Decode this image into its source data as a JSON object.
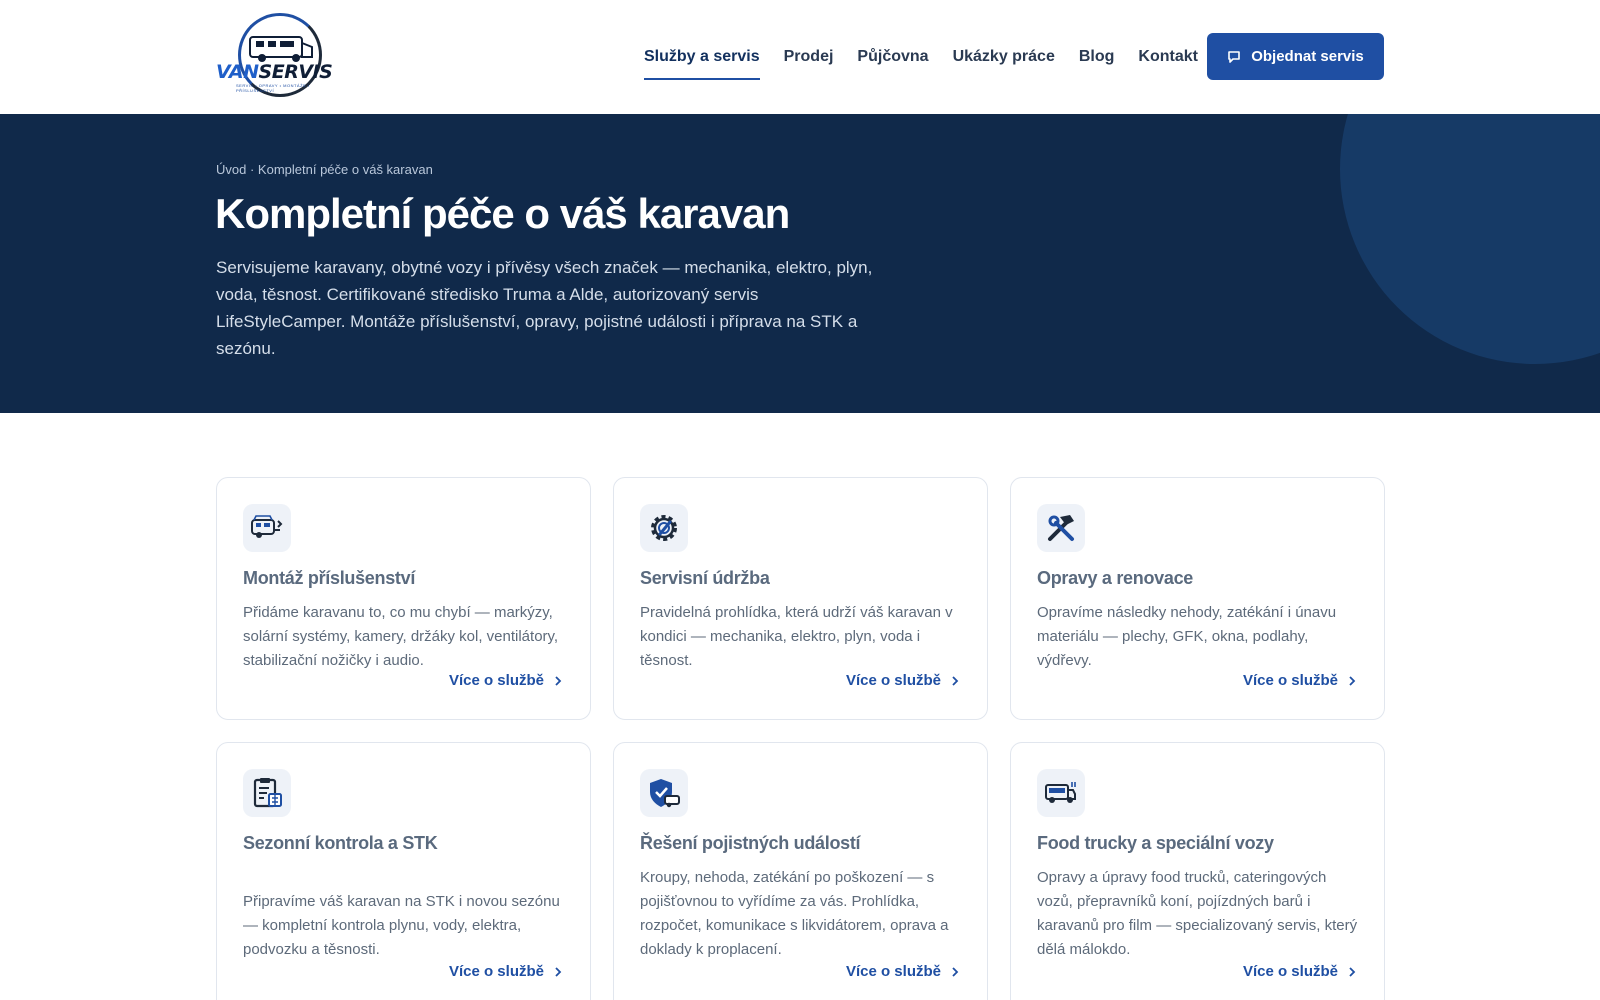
{
  "brand": {
    "logo_text_a": "VAN",
    "logo_text_b": "SERVIS",
    "logo_sub": "SERVIS • OPRAVY • MONTÁŽE • PŘÍSLUŠENSTVÍ"
  },
  "nav": {
    "items": [
      {
        "label": "Služby a servis",
        "active": true
      },
      {
        "label": "Prodej"
      },
      {
        "label": "Půjčovna"
      },
      {
        "label": "Ukázky práce"
      },
      {
        "label": "Blog"
      },
      {
        "label": "Kontakt"
      }
    ],
    "cta_label": "Objednat servis"
  },
  "hero": {
    "breadcrumb_home": "Úvod",
    "breadcrumb_sep": " · ",
    "breadcrumb_current": "Kompletní péče o váš karavan",
    "title": "Kompletní péče o váš karavan",
    "description": "Servisujeme karavany, obytné vozy i přívěsy všech značek — mechanika, elektro, plyn, voda, těsnost. Certifikované středisko Truma a Alde, autorizovaný servis LifeStyleCamper. Montáže příslušenství, opravy, pojistné události i příprava na STK a sezónu."
  },
  "services": [
    {
      "icon": "caravan-accessory-icon",
      "title": "Montáž příslušenství",
      "text": "Přidáme karavanu to, co mu chybí — markýzy, solární systémy, kamery, držáky kol, ventilátory, stabilizační nožičky i audio.",
      "link": "Více o službě"
    },
    {
      "icon": "gear-wrench-icon",
      "title": "Servisní údržba",
      "text": "Pravidelná prohlídka, která udrží váš karavan v kondici — mechanika, elektro, plyn, voda i těsnost.",
      "link": "Více o službě"
    },
    {
      "icon": "hammer-wrench-icon",
      "title": "Opravy a renovace",
      "text": "Opravíme následky nehody, zatékání i únavu materiálu — plechy, GFK, okna, podlahy, výdřevy.",
      "link": "Více o službě"
    },
    {
      "icon": "clipboard-checklist-icon",
      "title": "Sezonní kontrola a STK",
      "text": "Připravíme váš karavan na STK i novou sezónu — kompletní kontrola plynu, vody, elektra, podvozku a těsnosti.",
      "link": "Více o službě"
    },
    {
      "icon": "shield-caravan-icon",
      "title": "Řešení pojistných událostí",
      "text": "Kroupy, nehoda, zatékání po poškození — s pojišťovnou to vyřídíme za vás. Prohlídka, rozpočet, komunikace s likvidátorem, oprava a doklady k proplacení.",
      "link": "Více o službě"
    },
    {
      "icon": "food-truck-icon",
      "title": "Food trucky a speciální vozy",
      "text": "Opravy a úpravy food trucků, cateringových vozů, přepravníků koní, pojízdných barů i karavanů pro film — specializovaný servis, který dělá málokdo.",
      "link": "Více o službě"
    }
  ],
  "colors": {
    "primary": "#1f4fa3",
    "hero_bg": "#10294a",
    "hero_circle": "#163a66"
  }
}
